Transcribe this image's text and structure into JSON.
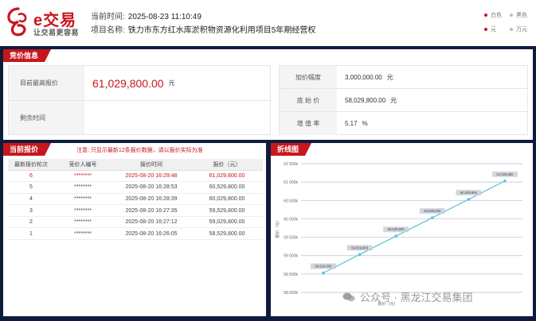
{
  "header": {
    "logo_text": "e交易",
    "slogan": "让交易更容易",
    "time_label": "当前时间:",
    "time_value": "2025-08-23 11:10:49",
    "project_label": "项目名称:",
    "project_value": "铁力市东方红水库淤积物资源化利用项目5年期经营权",
    "legend": {
      "l1": "白色",
      "l2": "黑色",
      "l3": "元",
      "l4": "万元"
    }
  },
  "bid_info": {
    "title": "竞价信息",
    "highest_label": "目前最高报价",
    "highest_value": "61,029,800.00",
    "unit": "元",
    "remaining_label": "剩余时间",
    "remaining_value": "",
    "increment_label": "加价幅度",
    "increment_value": "3,000,000.00",
    "base_label": "底 始 价",
    "base_value": "58,029,800.00",
    "rate_label": "增 值 率",
    "rate_value": "5.17",
    "rate_unit": "%"
  },
  "quotes": {
    "title": "当前报价",
    "note": "注意: 只显示最新12条报价数据，请以报价实际为准",
    "columns": [
      "最新报价轮次",
      "竞价人编号",
      "报价时间",
      "报价（元）"
    ],
    "rows": [
      {
        "round": "6",
        "bidder": "********",
        "time": "2025-08-20 16:29:48",
        "price": "61,029,800.00"
      },
      {
        "round": "5",
        "bidder": "********",
        "time": "2025-08-20 16:28:53",
        "price": "60,529,800.00"
      },
      {
        "round": "4",
        "bidder": "********",
        "time": "2025-08-20 16:28:39",
        "price": "60,029,800.00"
      },
      {
        "round": "3",
        "bidder": "********",
        "time": "2025-08-20 16:27:35",
        "price": "59,529,800.00"
      },
      {
        "round": "2",
        "bidder": "********",
        "time": "2025-08-20 16:27:12",
        "price": "59,029,800.00"
      },
      {
        "round": "1",
        "bidder": "********",
        "time": "2025-08-20 16:26:05",
        "price": "58,529,800.00"
      }
    ]
  },
  "chart_panel": {
    "title": "折线图"
  },
  "chart_data": {
    "type": "line",
    "x": [
      1,
      2,
      3,
      4,
      5,
      6
    ],
    "values": [
      58529800,
      59029800,
      59529800,
      60029800,
      60529800,
      61029800
    ],
    "point_labels": [
      "58,529,800",
      "59,029,800",
      "59,529,800",
      "60,029,800",
      "60,529,800",
      "61,029,800"
    ],
    "ylim": [
      58000000,
      61500000
    ],
    "yticks": [
      58000000,
      58500000,
      59000000,
      59500000,
      60000000,
      60500000,
      61000000,
      61500000
    ],
    "ytick_labels": [
      "58 000k",
      "58 500k",
      "59 000k",
      "59 500k",
      "60 000k",
      "60 500k",
      "61 000k",
      "61 500k"
    ],
    "ylabel": "报价（元）",
    "xlabel": "报价（元）",
    "line_color": "#5bc0de",
    "grid": true
  },
  "watermark": {
    "text": "公众号 · 黑龙江交易集团"
  },
  "colors": {
    "accent": "#c8161d",
    "background": "#0d1b3e"
  }
}
